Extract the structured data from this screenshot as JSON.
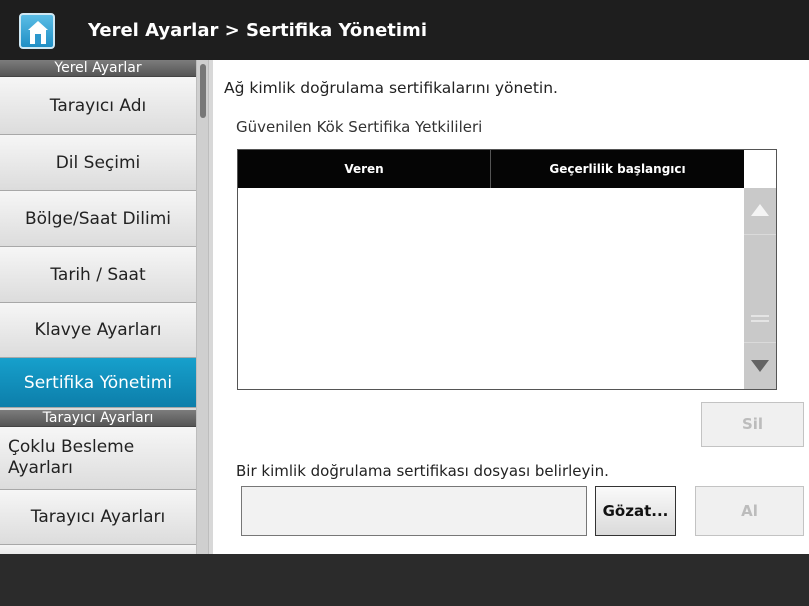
{
  "header": {
    "title": "Yerel Ayarlar > Sertifika Yönetimi",
    "home_icon": "home-icon"
  },
  "sidebar": {
    "section_local": "Yerel Ayarlar",
    "items": [
      {
        "label": "Tarayıcı Adı"
      },
      {
        "label": "Dil Seçimi"
      },
      {
        "label": "Bölge/Saat Dilimi"
      },
      {
        "label": "Tarih / Saat"
      },
      {
        "label": "Klavye Ayarları"
      },
      {
        "label": "Sertifika Yönetimi",
        "active": true
      }
    ],
    "section_scanner": "Tarayıcı Ayarları",
    "scanner_items": [
      {
        "label": "Çoklu Besleme Ayarları"
      },
      {
        "label": "Tarayıcı Ayarları"
      }
    ]
  },
  "main": {
    "description": "Ağ kimlik doğrulama sertifikalarını yönetin.",
    "trusted_title": "Güvenilen Kök Sertifika Yetkilileri",
    "table": {
      "columns": [
        "Veren",
        "Geçerlilik başlangıcı"
      ],
      "rows": []
    },
    "delete_label": "Sil",
    "file_prompt": "Bir kimlik doğrulama sertifikası dosyası belirleyin.",
    "file_value": "",
    "browse_label": "Gözat...",
    "get_label": "Al"
  },
  "colors": {
    "accent": "#0d8fbf",
    "header_bg": "#1e1e1e"
  }
}
